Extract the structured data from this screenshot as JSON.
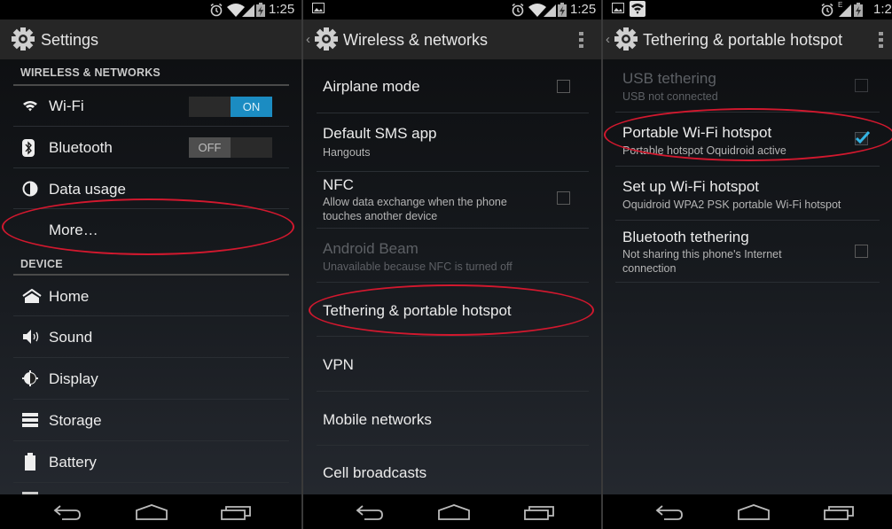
{
  "status": {
    "time": "1:25",
    "time_partial": "1:2",
    "icons": [
      "alarm-icon",
      "wifi-signal-icon",
      "cell-signal-icon",
      "battery-charging-icon"
    ]
  },
  "panel1": {
    "title": "Settings",
    "sections": [
      {
        "header": "WIRELESS & NETWORKS",
        "items": [
          {
            "label": "Wi-Fi",
            "icon": "wifi-icon",
            "toggle": "ON"
          },
          {
            "label": "Bluetooth",
            "icon": "bluetooth-icon",
            "toggle": "OFF"
          },
          {
            "label": "Data usage",
            "icon": "data-usage-icon"
          },
          {
            "label": "More…",
            "highlighted": true
          }
        ]
      },
      {
        "header": "DEVICE",
        "items": [
          {
            "label": "Home",
            "icon": "home-icon"
          },
          {
            "label": "Sound",
            "icon": "sound-icon"
          },
          {
            "label": "Display",
            "icon": "display-icon"
          },
          {
            "label": "Storage",
            "icon": "storage-icon"
          },
          {
            "label": "Battery",
            "icon": "battery-icon"
          }
        ]
      }
    ]
  },
  "panel2": {
    "title": "Wireless & networks",
    "items": [
      {
        "label": "Airplane mode",
        "checkbox": false
      },
      {
        "label": "Default SMS app",
        "summary": "Hangouts"
      },
      {
        "label": "NFC",
        "summary": "Allow data exchange when the phone touches another device",
        "checkbox": false
      },
      {
        "label": "Android Beam",
        "summary": "Unavailable because NFC is turned off",
        "disabled": true
      },
      {
        "label": "Tethering & portable hotspot",
        "highlighted": true
      },
      {
        "label": "VPN"
      },
      {
        "label": "Mobile networks"
      },
      {
        "label": "Cell broadcasts"
      }
    ]
  },
  "panel3": {
    "title": "Tethering & portable hotspot",
    "items": [
      {
        "label": "USB tethering",
        "summary": "USB not connected",
        "checkbox": false,
        "disabled": true
      },
      {
        "label": "Portable Wi-Fi hotspot",
        "summary": "Portable hotspot Oquidroid active",
        "checkbox": true,
        "highlighted": true
      },
      {
        "label": "Set up Wi-Fi hotspot",
        "summary": "Oquidroid WPA2 PSK portable Wi-Fi hotspot"
      },
      {
        "label": "Bluetooth tethering",
        "summary": "Not sharing this phone's Internet connection",
        "checkbox": false
      }
    ]
  },
  "colors": {
    "accent": "#1b8cc2",
    "highlight_ellipse": "#d2182e",
    "actionbar": "#262626"
  }
}
